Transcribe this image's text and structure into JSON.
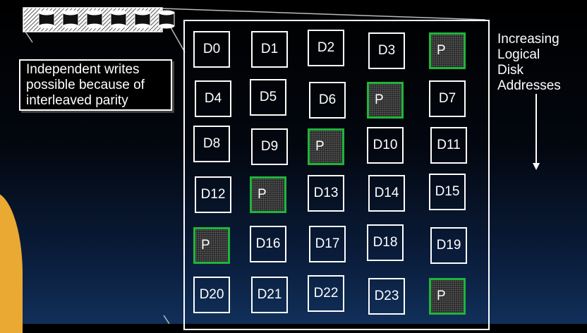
{
  "diagram": {
    "callout": {
      "text": "Independent writes possible because of interleaved parity"
    },
    "side_label": {
      "lines": [
        "Increasing",
        "Logical",
        "Disk",
        "Addresses"
      ]
    },
    "grid": {
      "columns": 5,
      "rows": [
        [
          "D0",
          "D1",
          "D2",
          "D3",
          "P"
        ],
        [
          "D4",
          "D5",
          "D6",
          "P",
          "D7"
        ],
        [
          "D8",
          "D9",
          "P",
          "D10",
          "D11"
        ],
        [
          "D12",
          "P",
          "D13",
          "D14",
          "D15"
        ],
        [
          "P",
          "D16",
          "D17",
          "D18",
          "D19"
        ],
        [
          "D20",
          "D21",
          "D22",
          "D23",
          "P"
        ]
      ]
    },
    "colors": {
      "parity_border": "#1fb53a",
      "cell_border": "#ffffff",
      "background": "#000000"
    },
    "icons": {
      "disk_array": "disk-cylinder-icon",
      "direction": "arrow-down-icon"
    }
  }
}
